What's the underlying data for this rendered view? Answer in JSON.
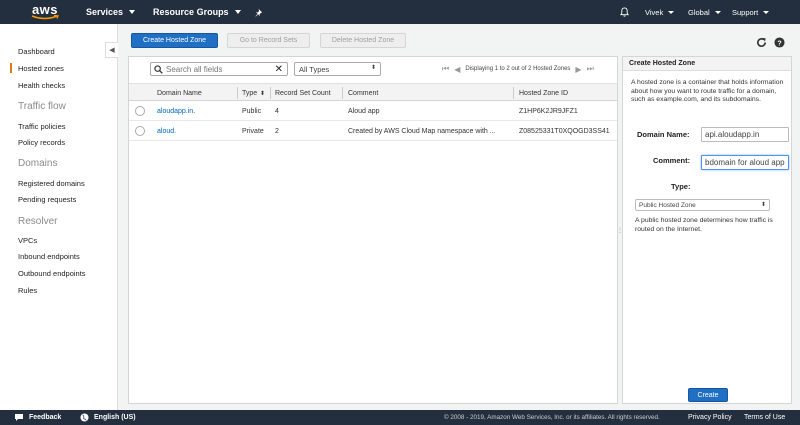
{
  "nav": {
    "logo_text": "aws",
    "services": "Services",
    "resource_groups": "Resource Groups",
    "user": "Vivek",
    "region": "Global",
    "support": "Support"
  },
  "sidebar": {
    "items": [
      {
        "label": "Dashboard"
      },
      {
        "label": "Hosted zones"
      },
      {
        "label": "Health checks"
      }
    ],
    "traffic_flow": {
      "heading": "Traffic flow",
      "items": [
        {
          "label": "Traffic policies"
        },
        {
          "label": "Policy records"
        }
      ]
    },
    "domains": {
      "heading": "Domains",
      "items": [
        {
          "label": "Registered domains"
        },
        {
          "label": "Pending requests"
        }
      ]
    },
    "resolver": {
      "heading": "Resolver",
      "items": [
        {
          "label": "VPCs"
        },
        {
          "label": "Inbound endpoints"
        },
        {
          "label": "Outbound endpoints"
        },
        {
          "label": "Rules"
        }
      ]
    }
  },
  "toolbar": {
    "create_hosted_zone": "Create Hosted Zone",
    "go_to_record_sets": "Go to Record Sets",
    "delete_hosted_zone": "Delete Hosted Zone"
  },
  "table": {
    "search_placeholder": "Search all fields",
    "filter_value": "All Types",
    "pagination_text": "Displaying 1 to 2 out of 2 Hosted Zones",
    "columns": [
      "Domain Name",
      "Type",
      "Record Set Count",
      "Comment",
      "Hosted Zone ID"
    ],
    "rows": [
      {
        "domain": "aloudapp.in.",
        "type": "Public",
        "count": "4",
        "comment": "Aloud app",
        "zone_id": "Z1HP6K2JR9JFZ1"
      },
      {
        "domain": "aloud.",
        "type": "Private",
        "count": "2",
        "comment": "Created by AWS Cloud Map namespace with ...",
        "zone_id": "Z08525331T0XQOGD3SS41"
      }
    ]
  },
  "panel": {
    "title": "Create Hosted Zone",
    "description": "A hosted zone is a container that holds information about how you want to route traffic for a domain, such as example.com, and its subdomains.",
    "domain_label": "Domain Name:",
    "domain_value": "api.aloudapp.in",
    "comment_label": "Comment:",
    "comment_value": "bdomain for aloud app",
    "type_label": "Type:",
    "type_value": "Public Hosted Zone",
    "type_note": "A public hosted zone determines how traffic is routed on the Internet.",
    "create_button": "Create"
  },
  "footer": {
    "feedback": "Feedback",
    "language": "English (US)",
    "copyright": "© 2008 - 2019, Amazon Web Services, Inc. or its affiliates. All rights reserved.",
    "privacy": "Privacy Policy",
    "terms": "Terms of Use"
  },
  "colors": {
    "nav_bg": "#232f3e",
    "primary": "#1f6fc5",
    "accent": "#e47911",
    "link": "#0066c0"
  }
}
